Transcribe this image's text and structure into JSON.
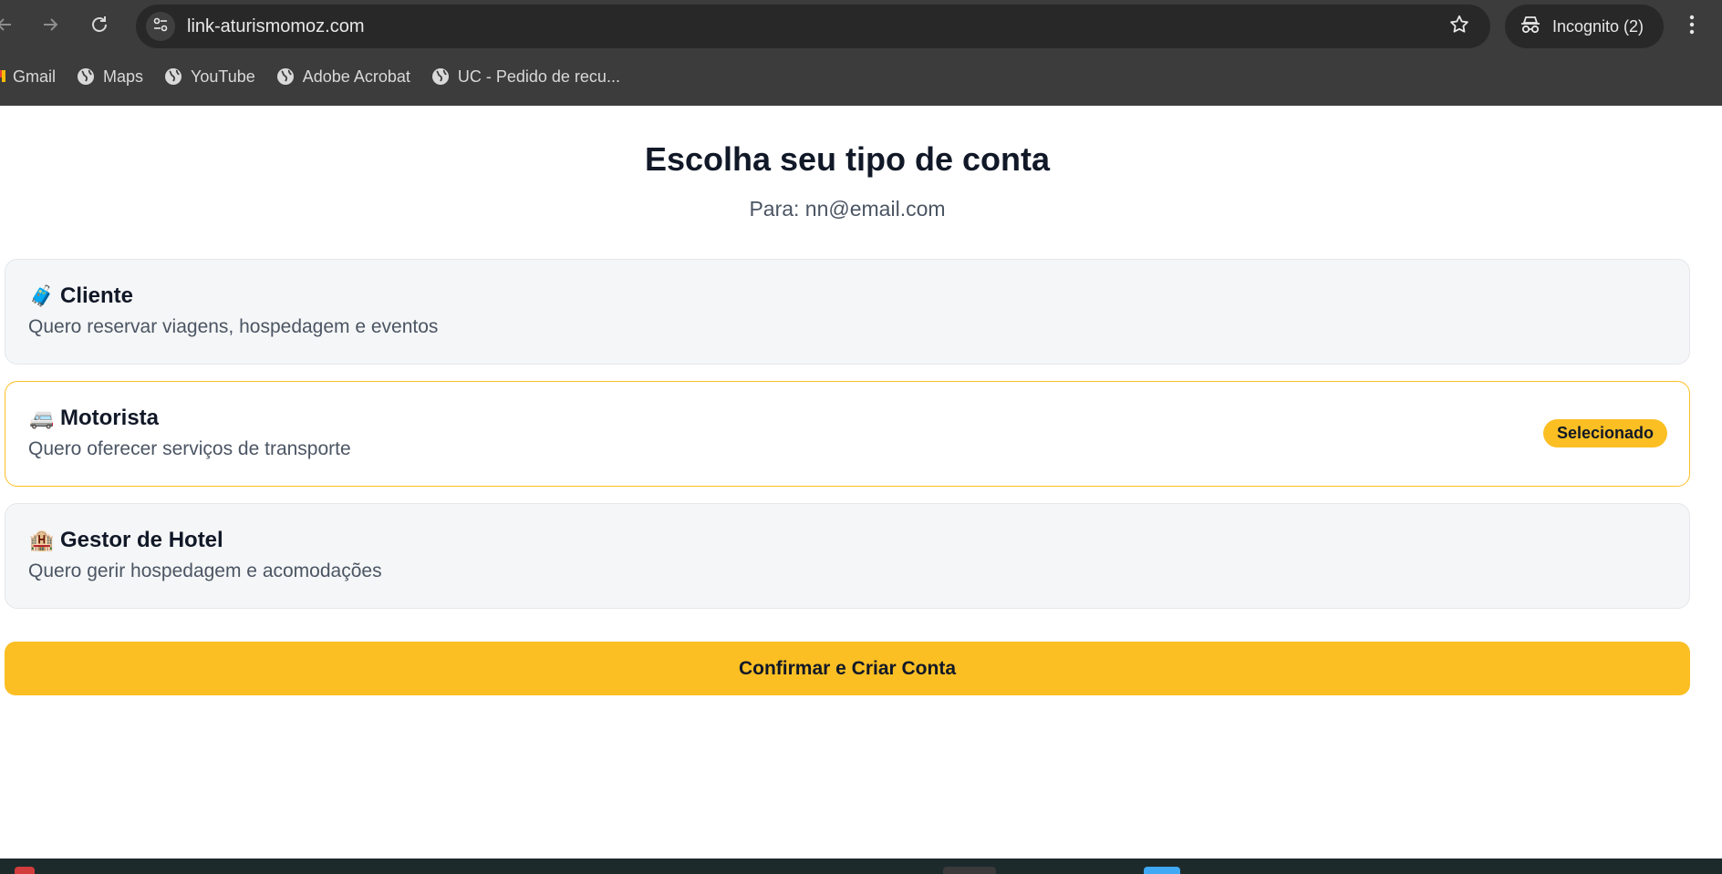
{
  "browser": {
    "url": "link-aturismomoz.com",
    "incognito_label": "Incognito (2)",
    "bookmarks": [
      {
        "label": "Gmail",
        "icon": "gmail-icon"
      },
      {
        "label": "Maps",
        "icon": "globe-icon"
      },
      {
        "label": "YouTube",
        "icon": "globe-icon"
      },
      {
        "label": "Adobe Acrobat",
        "icon": "globe-icon"
      },
      {
        "label": "UC - Pedido de recu...",
        "icon": "globe-icon"
      }
    ]
  },
  "page": {
    "title": "Escolha seu tipo de conta",
    "subtitle": "Para: nn@email.com",
    "options": [
      {
        "emoji": "🧳",
        "title": "Cliente",
        "description": "Quero reservar viagens, hospedagem e eventos",
        "selected": false
      },
      {
        "emoji": "🚐",
        "title": "Motorista",
        "description": "Quero oferecer serviços de transporte",
        "selected": true,
        "badge": "Selecionado"
      },
      {
        "emoji": "🏨",
        "title": "Gestor de Hotel",
        "description": "Quero gerir hospedagem e acomodações",
        "selected": false
      }
    ],
    "confirm_label": "Confirmar e Criar Conta"
  },
  "colors": {
    "accent": "#fbbf24",
    "selected_border": "#fbbf24",
    "card_bg": "#f5f6f7",
    "chrome_bg": "#3c3c3c"
  }
}
